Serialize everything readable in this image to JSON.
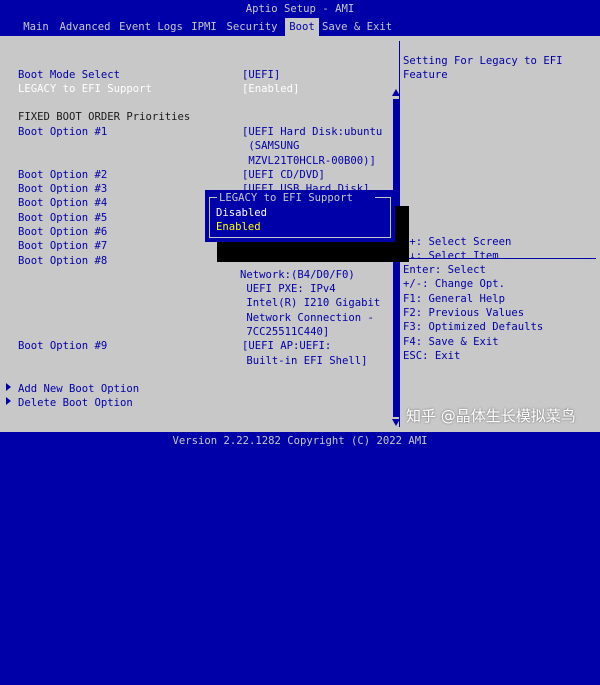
{
  "window": {
    "title": "Aptio Setup - AMI"
  },
  "menu": {
    "tabs": [
      {
        "label": "Main"
      },
      {
        "label": "Advanced"
      },
      {
        "label": "Event Logs"
      },
      {
        "label": "IPMI"
      },
      {
        "label": "Security"
      },
      {
        "label": "Boot"
      },
      {
        "label": "Save & Exit"
      }
    ],
    "active": "Boot"
  },
  "settings": {
    "boot_mode_select": {
      "label": "Boot Mode Select",
      "value": "[UEFI]"
    },
    "legacy_to_efi": {
      "label": "LEGACY to EFI Support",
      "value": "[Enabled]"
    },
    "section_heading": "FIXED BOOT ORDER Priorities",
    "boot_options": [
      {
        "label": "Boot Option #1",
        "lines": [
          "[UEFI Hard Disk:ubuntu",
          " (SAMSUNG",
          " MZVL21T0HCLR-00B00)]"
        ]
      },
      {
        "label": "Boot Option #2",
        "lines": [
          "[UEFI CD/DVD]"
        ]
      },
      {
        "label": "Boot Option #3",
        "lines": [
          "[UEFI USB Hard Disk]"
        ]
      },
      {
        "label": "Boot Option #4",
        "lines": []
      },
      {
        "label": "Boot Option #5",
        "lines": []
      },
      {
        "label": "Boot Option #6",
        "lines": []
      },
      {
        "label": "Boot Option #7",
        "lines": []
      },
      {
        "label": "Boot Option #8",
        "lines": [
          "Network:(B4/D0/F0)",
          " UEFI PXE: IPv4",
          " Intel(R) I210 Gigabit",
          " Network Connection -",
          " 7CC25511C440]"
        ]
      },
      {
        "label": "Boot Option #9",
        "lines": [
          "[UEFI AP:UEFI:",
          " Built-in EFI Shell]"
        ]
      }
    ],
    "links": [
      {
        "label": "Add New Boot Option"
      },
      {
        "label": "Delete Boot Option"
      }
    ]
  },
  "help": {
    "lines": [
      "Setting For Legacy to EFI",
      "Feature"
    ]
  },
  "keys": [
    "++: Select Screen",
    "↑↓: Select Item",
    "Enter: Select",
    "+/-: Change Opt.",
    "F1: General Help",
    "F2: Previous Values",
    "F3: Optimized Defaults",
    "F4: Save & Exit",
    "ESC: Exit"
  ],
  "popup": {
    "title": "LEGACY to EFI Support",
    "options": [
      "Disabled",
      "Enabled"
    ],
    "selected": "Enabled"
  },
  "footer": {
    "text": "Version 2.22.1282 Copyright (C) 2022 AMI"
  },
  "watermark": {
    "text": "知乎 @晶体生长模拟菜鸟"
  },
  "colors": {
    "background": "#0000a8",
    "panel": "#c8c8c8",
    "highlight": "#ffffff",
    "selected_text": "#ffff00"
  }
}
